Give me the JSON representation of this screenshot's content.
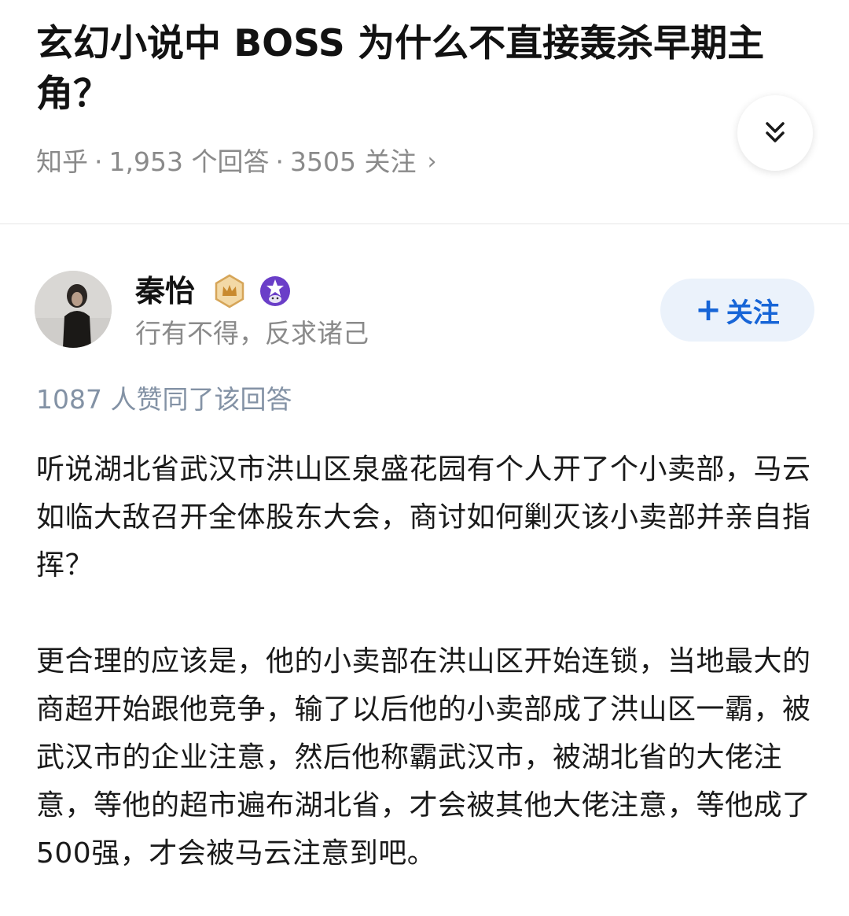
{
  "question": {
    "title": "玄幻小说中 BOSS 为什么不直接轰杀早期主角？",
    "source": "知乎",
    "answer_count": "1,953 个回答",
    "follower_count": "3505 关注",
    "separator": "·",
    "more_chevron": "›"
  },
  "author": {
    "name": "秦怡",
    "signature": "行有不得，反求诸己",
    "follow_plus": "+",
    "follow_label": "关注",
    "badges": [
      "crown-badge-icon",
      "star-badge-icon"
    ]
  },
  "answer": {
    "upvote_text": "1087 人赞同了该回答",
    "paragraphs": [
      "听说湖北省武汉市洪山区泉盛花园有个人开了个小卖部，马云如临大敌召开全体股东大会，商讨如何剿灭该小卖部并亲自指挥？",
      "更合理的应该是，他的小卖部在洪山区开始连锁，当地最大的商超开始跟他竞争，输了以后他的小卖部成了洪山区一霸，被武汉市的企业注意，然后他称霸武汉市，被湖北省的大佬注意，等他的超市遍布湖北省，才会被其他大佬注意，等他成了500强，才会被马云注意到吧。"
    ]
  },
  "colors": {
    "accent": "#1765d7",
    "follow_bg": "#ebf2fb",
    "meta_gray": "#8a8a8a",
    "upvote_blue_gray": "#8392a5"
  }
}
